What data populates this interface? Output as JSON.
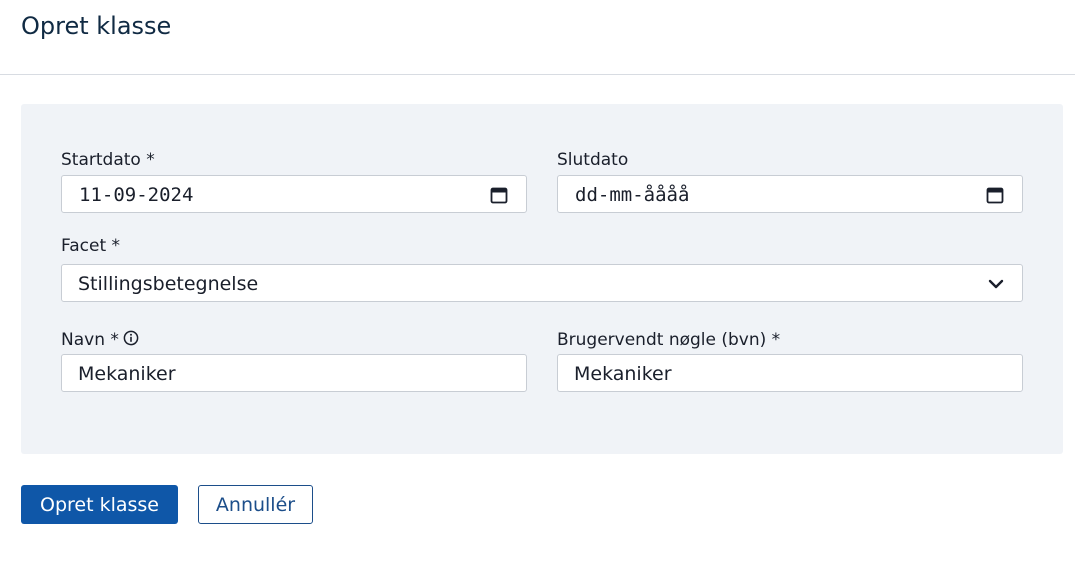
{
  "header": {
    "title": "Opret klasse"
  },
  "form": {
    "startdato": {
      "label": "Startdato *",
      "value": "11-09-2024"
    },
    "slutdato": {
      "label": "Slutdato",
      "placeholder": "dd-mm-åååå"
    },
    "facet": {
      "label": "Facet *",
      "selected": "Stillingsbetegnelse"
    },
    "navn": {
      "label": "Navn *",
      "value": "Mekaniker"
    },
    "bvn": {
      "label": "Brugervendt nøgle (bvn) *",
      "value": "Mekaniker"
    }
  },
  "actions": {
    "submit_label": "Opret klasse",
    "cancel_label": "Annullér"
  },
  "icons": {
    "date": "calendar-icon",
    "select": "chevron-down-icon",
    "info": "info-icon"
  },
  "colors": {
    "primary": "#0f57a8",
    "panel": "#f0f3f7",
    "title": "#102a43"
  }
}
